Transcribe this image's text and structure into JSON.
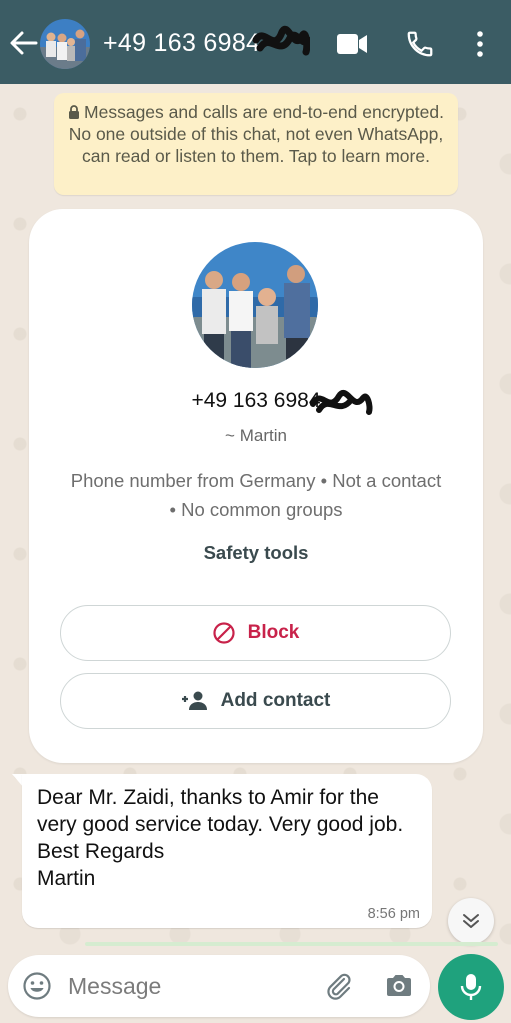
{
  "header": {
    "title": "+49 163 6984",
    "back_icon": "arrow-left-icon",
    "video_icon": "video-camera-icon",
    "call_icon": "phone-icon",
    "menu_icon": "more-vertical-icon",
    "background": "#3b5c64"
  },
  "encryption_notice": {
    "text": "Messages and calls are end-to-end encrypted. No one outside of this chat, not even WhatsApp, can read or listen to them. Tap to learn more.",
    "icon": "lock-icon",
    "background": "#fdf0c8"
  },
  "contact_card": {
    "phone": "+49 163 6984",
    "name": "~ Martin",
    "info": "Phone number from Germany • Not a contact • No common groups",
    "safety_tools_label": "Safety tools",
    "block_label": "Block",
    "add_contact_label": "Add contact",
    "block_color": "#c8224a"
  },
  "message": {
    "text": "Dear Mr. Zaidi, thanks to Amir for the very good service today. Very good job.\nBest Regards\nMartin",
    "time": "8:56 pm"
  },
  "composer": {
    "placeholder": "Message",
    "emoji_icon": "emoji-icon",
    "attach_icon": "paperclip-icon",
    "camera_icon": "camera-icon",
    "mic_icon": "microphone-icon",
    "accent": "#1fa27d"
  }
}
